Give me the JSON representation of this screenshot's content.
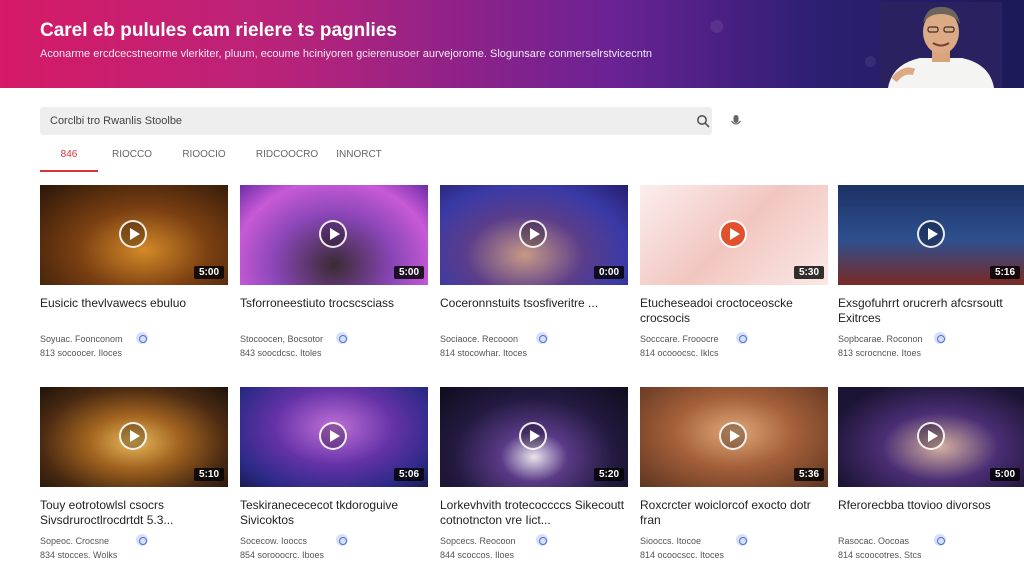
{
  "banner": {
    "title": "Carel eb pulules cam rielere ts pagnlies",
    "subtitle": "Aconarme ercdcecstneorme vlerkiter, pluum, ecoume hciniyoren gcierenusoer aurvejorome. Slogunsare conmerselrstvicecntn"
  },
  "search": {
    "placeholder": "Corclbi tro Rwanlis Stoolbe"
  },
  "tabs": [
    {
      "label": "846"
    },
    {
      "label": "RIOCCO"
    },
    {
      "label": "RIOOCIO"
    },
    {
      "label": "RIDCOOCRO"
    },
    {
      "label": "INNORCT"
    }
  ],
  "videos": [
    {
      "title": "Eusicic thevlvawecs ebuluo",
      "channel": "Soyuac. Foonconom",
      "stats": "813 socoocer. Iloces",
      "duration": "5:00"
    },
    {
      "title": "Tsforroneestiuto trocscsciass",
      "channel": "Stocoocen, Bocsotor",
      "stats": "843 soocdcsc. Itoles",
      "duration": "5:00"
    },
    {
      "title": "Coceronnstuits tsosfiveritre ...",
      "channel": "Sociaoce. Recooon",
      "stats": "814 stocowhar. Itoces",
      "duration": "0:00"
    },
    {
      "title": "Etucheseadoi croctoceoscke crocsocis",
      "channel": "Socccare. Frooocre",
      "stats": "814 ocooocsc. Iklcs",
      "duration": "5:30"
    },
    {
      "title": "Exsgofuhrrt orucrerh afcsrsoutt Exitrces",
      "channel": "Sopbcarae. Roconon",
      "stats": "813 scrocncne. Itoes",
      "duration": "5:16"
    },
    {
      "title": "Touy eotrotowlsl csocrs Sivsdruroctlrocdrtdt 5.3...",
      "channel": "Sopeoc. Crocsne",
      "stats": "834 stocces. Wolks",
      "duration": "5:10"
    },
    {
      "title": "Teskiranecececot tkdoroguive Sivicoktos",
      "channel": "Socecow. Iooccs",
      "stats": "854 sorooocrc. Iboes",
      "duration": "5:06"
    },
    {
      "title": "Lorkevhvith trotecoccccs Sikecoutt cotnotncton vre Iict...",
      "channel": "Sopcecs. Reocoon",
      "stats": "844 scoccos. Iloes",
      "duration": "5:20"
    },
    {
      "title": "Roxcrcter woiclorcof exocto dotr fran",
      "channel": "Siooccs. Itocoe",
      "stats": "814 ocoocscc. Itoces",
      "duration": "5:36"
    },
    {
      "title": "Rferorecbba ttovioo divorsos",
      "channel": "Rasocac. Oocoas",
      "stats": "814 scoocotres. Stcs",
      "duration": "5:00"
    }
  ]
}
